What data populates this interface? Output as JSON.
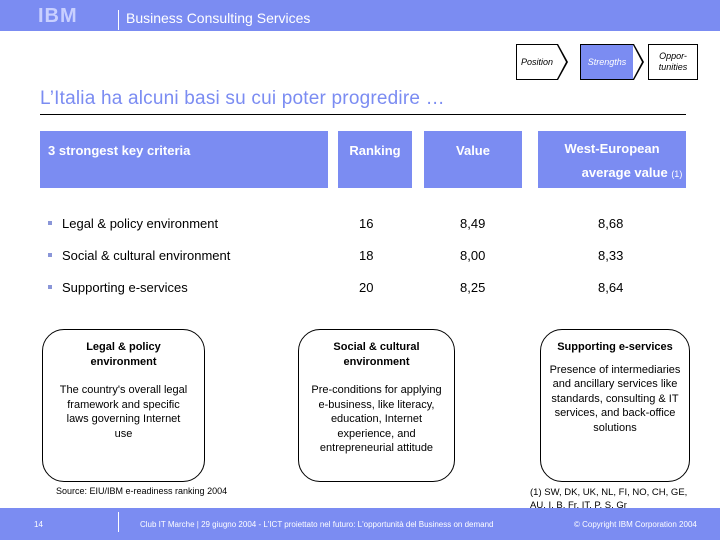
{
  "header": {
    "logo": "IBM",
    "brand": "Business Consulting Services",
    "accent_color": "#7b8cf2"
  },
  "process": {
    "steps": [
      {
        "label": "Position",
        "active": false
      },
      {
        "label": "Strengths",
        "active": true
      },
      {
        "label": "Oppor-tunities",
        "active": false
      }
    ]
  },
  "title": "L’Italia ha alcuni basi su cui poter progredire …",
  "table": {
    "headers": {
      "criteria": "3 strongest key criteria",
      "ranking": "Ranking",
      "value": "Value",
      "west": "West-European",
      "west_sub": "average value",
      "west_note": "(1)"
    },
    "rows": [
      {
        "criteria": "Legal & policy environment",
        "ranking": "16",
        "value": "8,49",
        "west": "8,68"
      },
      {
        "criteria": "Social & cultural environment",
        "ranking": "18",
        "value": "8,00",
        "west": "8,33"
      },
      {
        "criteria": "Supporting e-services",
        "ranking": "20",
        "value": "8,25",
        "west": "8,64"
      }
    ]
  },
  "boxes": [
    {
      "title": "Legal & policy environment",
      "text": "The country's overall legal framework and specific laws governing Internet use"
    },
    {
      "title": "Social & cultural environment",
      "text": "Pre-conditions for applying e-business, like literacy, education, Internet experience, and entrepreneurial attitude"
    },
    {
      "title": "Supporting e-services",
      "text": "Presence of intermediaries and ancillary services like standards, consulting & IT services, and back-office solutions"
    }
  ],
  "source": "Source: EIU/IBM e-readiness ranking 2004",
  "note": "(1) SW, DK, UK, NL, FI, NO, CH, GE, AU, I, B, Fr, IT, P, S, Gr",
  "footer": {
    "page": "14",
    "event": "Club IT Marche | 29 giugno 2004 - L'ICT proiettato nel futuro: L'opportunità del Business on demand",
    "copyright": "© Copyright IBM Corporation 2004"
  }
}
